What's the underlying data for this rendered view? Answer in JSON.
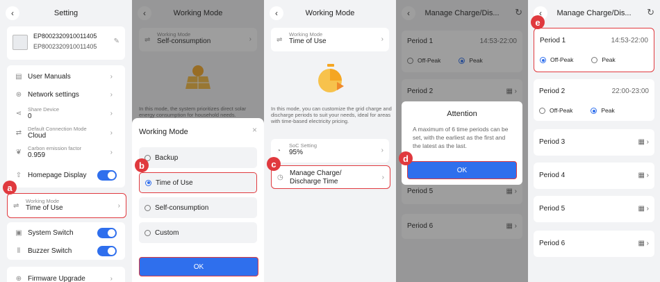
{
  "panel1": {
    "title": "Setting",
    "device": {
      "name": "EP8002320910011405",
      "serial": "EP8002320910011405"
    },
    "menu": [
      {
        "label": "User Manuals"
      },
      {
        "label": "Network settings"
      }
    ],
    "share_device": {
      "label": "Share Device",
      "value": "0"
    },
    "connection_mode": {
      "label": "Default Connection Mode",
      "value": "Cloud"
    },
    "carbon_factor": {
      "label": "Carbon emission factor",
      "value": "0.959"
    },
    "homepage_display": {
      "label": "Homepage Display",
      "toggle_on": true
    },
    "working_mode": {
      "label": "Working Mode",
      "value": "Time of Use"
    },
    "system_switch": {
      "label": "System Switch",
      "toggle_on": true
    },
    "buzzer_switch": {
      "label": "Buzzer Switch",
      "toggle_on": true
    },
    "firmware_upgrade": {
      "label": "Firmware Upgrade"
    }
  },
  "panel2": {
    "title": "Working Mode",
    "mode_card": {
      "label": "Working Mode",
      "value": "Self-consumption"
    },
    "description": "In this mode, the system prioritizes direct solar energy consumption for household needs.",
    "sheet_title": "Working Mode",
    "options": [
      "Backup",
      "Time of Use",
      "Self-consumption",
      "Custom"
    ],
    "selected_index": 1,
    "ok_label": "OK"
  },
  "panel3": {
    "title": "Working Mode",
    "mode_card": {
      "label": "Working Mode",
      "value": "Time of Use"
    },
    "description": "In this mode, you can customize the grid charge and discharge periods to suit your needs, ideal for areas with time-based electricity pricing.",
    "soc": {
      "label": "SoC Setting",
      "value": "95%"
    },
    "manage_label": "Manage Charge/ Discharge Time"
  },
  "panel4": {
    "title": "Manage Charge/Dis...",
    "periods": [
      {
        "label": "Period 1",
        "time": "14:53-22:00"
      },
      {
        "label": "Period 2",
        "time": ""
      },
      {
        "label": "Period 5",
        "time": ""
      },
      {
        "label": "Period 6",
        "time": ""
      }
    ],
    "off_peak": "Off-Peak",
    "peak": "Peak",
    "dialog": {
      "title": "Attention",
      "message": "A maximum of 6 time periods can be set, with the earliest as the first and the latest as the last.",
      "ok": "OK"
    }
  },
  "panel5": {
    "title": "Manage Charge/Dis...",
    "periods": [
      {
        "label": "Period 1",
        "time": "14:53-22:00",
        "peak": false
      },
      {
        "label": "Period 2",
        "time": "22:00-23:00",
        "peak": true
      },
      {
        "label": "Period 3",
        "time": ""
      },
      {
        "label": "Period 4",
        "time": ""
      },
      {
        "label": "Period 5",
        "time": ""
      },
      {
        "label": "Period 6",
        "time": ""
      }
    ],
    "off_peak": "Off-Peak",
    "peak": "Peak"
  },
  "badges": {
    "a": "a",
    "b": "b",
    "c": "c",
    "d": "d",
    "e": "e"
  },
  "colors": {
    "accent": "#2f6fed",
    "highlight": "#e0393e",
    "background": "#f2f3f5"
  }
}
